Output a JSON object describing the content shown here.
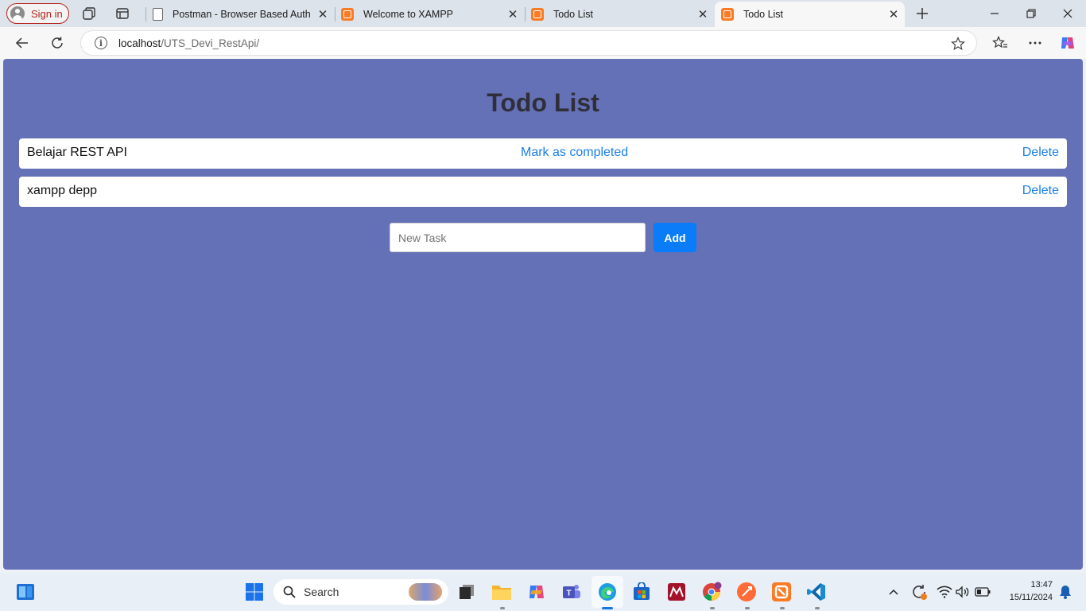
{
  "browser": {
    "signin_label": "Sign in",
    "tabs": [
      {
        "title": "Postman - Browser Based Auth",
        "favicon": "document-icon"
      },
      {
        "title": "Welcome to XAMPP",
        "favicon": "xampp-icon"
      },
      {
        "title": "Todo List",
        "favicon": "xampp-icon"
      },
      {
        "title": "Todo List",
        "favicon": "xampp-icon",
        "active": true
      }
    ],
    "url_host": "localhost",
    "url_path": "/UTS_Devi_RestApi/"
  },
  "page": {
    "title": "Todo List",
    "todos": [
      {
        "text": "Belajar REST API",
        "complete_label": "Mark as completed",
        "delete_label": "Delete"
      },
      {
        "text": "xampp depp",
        "delete_label": "Delete"
      }
    ],
    "new_task_placeholder": "New Task",
    "new_task_value": "",
    "add_label": "Add"
  },
  "taskbar": {
    "search_label": "Search",
    "time": "13:47",
    "date": "15/11/2024"
  },
  "colors": {
    "page_background": "#6571b7",
    "link": "#1a7fe6",
    "add_button": "#0a7cf7",
    "title": "#2f2f3a"
  }
}
